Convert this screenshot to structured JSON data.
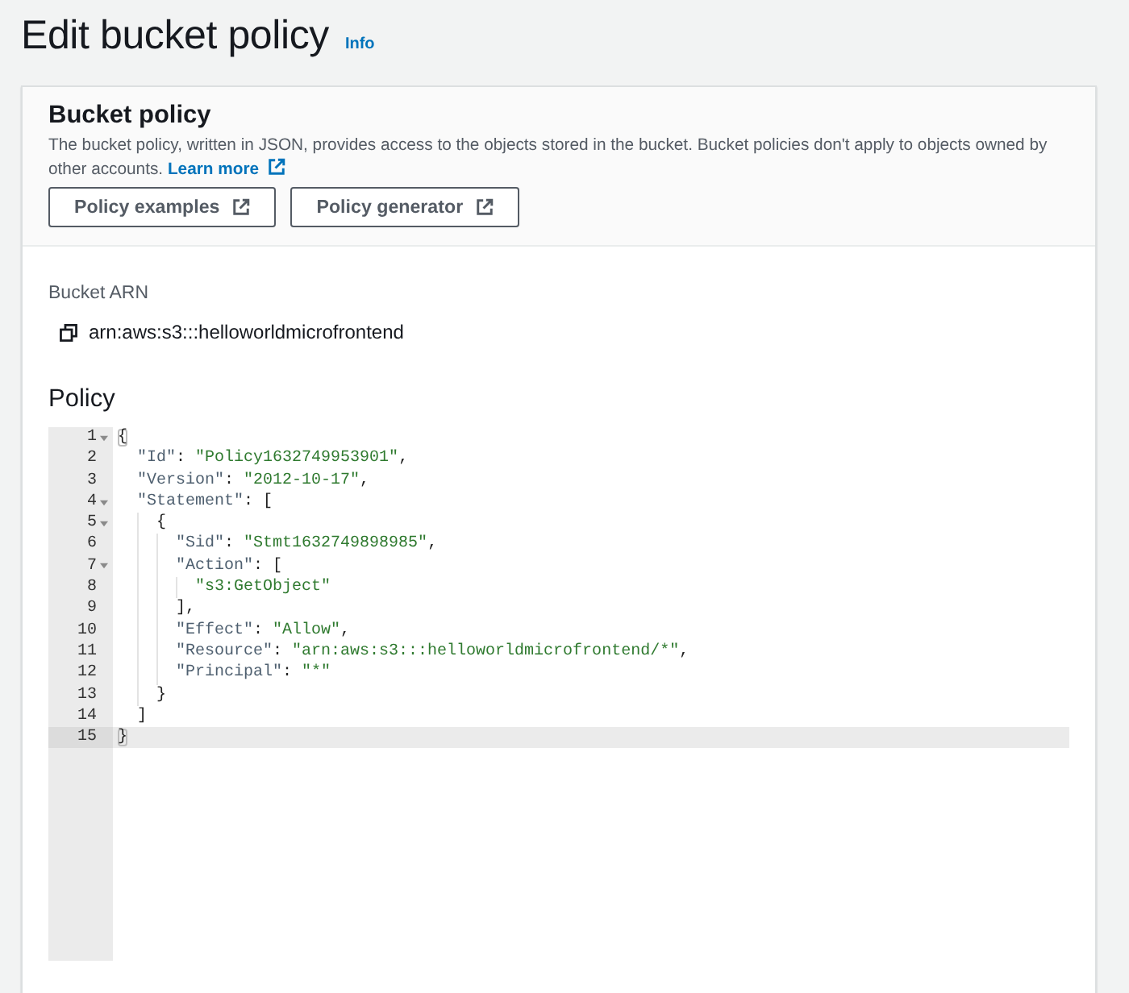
{
  "page": {
    "title": "Edit bucket policy",
    "info_link": "Info"
  },
  "bucket_policy": {
    "title": "Bucket policy",
    "description": "The bucket policy, written in JSON, provides access to the objects stored in the bucket. Bucket policies don't apply to objects owned by other accounts.",
    "learn_more": "Learn more",
    "buttons": [
      "Policy examples",
      "Policy generator"
    ]
  },
  "bucket_arn": {
    "label": "Bucket ARN",
    "value": "arn:aws:s3:::helloworldmicrofrontend"
  },
  "policy": {
    "title": "Policy",
    "editor": {
      "lines": [
        {
          "number": "1",
          "foldable": true,
          "active": false,
          "tokens": [
            {
              "kind": "match",
              "text": "{"
            }
          ]
        },
        {
          "number": "2",
          "foldable": false,
          "active": false,
          "tokens": [
            {
              "kind": "key",
              "text": "  \"Id\""
            },
            {
              "kind": "punct",
              "text": ": "
            },
            {
              "kind": "string",
              "text": "\"Policy1632749953901\""
            },
            {
              "kind": "punct",
              "text": ","
            }
          ]
        },
        {
          "number": "3",
          "foldable": false,
          "active": false,
          "tokens": [
            {
              "kind": "key",
              "text": "  \"Version\""
            },
            {
              "kind": "punct",
              "text": ": "
            },
            {
              "kind": "string",
              "text": "\"2012-10-17\""
            },
            {
              "kind": "punct",
              "text": ","
            }
          ]
        },
        {
          "number": "4",
          "foldable": true,
          "active": false,
          "tokens": [
            {
              "kind": "key",
              "text": "  \"Statement\""
            },
            {
              "kind": "punct",
              "text": ": ["
            }
          ]
        },
        {
          "number": "5",
          "foldable": true,
          "active": false,
          "tokens": [
            {
              "kind": "punct",
              "text": "    {"
            }
          ]
        },
        {
          "number": "6",
          "foldable": false,
          "active": false,
          "tokens": [
            {
              "kind": "key",
              "text": "      \"Sid\""
            },
            {
              "kind": "punct",
              "text": ": "
            },
            {
              "kind": "string",
              "text": "\"Stmt1632749898985\""
            },
            {
              "kind": "punct",
              "text": ","
            }
          ]
        },
        {
          "number": "7",
          "foldable": true,
          "active": false,
          "tokens": [
            {
              "kind": "key",
              "text": "      \"Action\""
            },
            {
              "kind": "punct",
              "text": ": ["
            }
          ]
        },
        {
          "number": "8",
          "foldable": false,
          "active": false,
          "tokens": [
            {
              "kind": "string",
              "text": "        \"s3:GetObject\""
            }
          ]
        },
        {
          "number": "9",
          "foldable": false,
          "active": false,
          "tokens": [
            {
              "kind": "punct",
              "text": "      ],"
            }
          ]
        },
        {
          "number": "10",
          "foldable": false,
          "active": false,
          "tokens": [
            {
              "kind": "key",
              "text": "      \"Effect\""
            },
            {
              "kind": "punct",
              "text": ": "
            },
            {
              "kind": "string",
              "text": "\"Allow\""
            },
            {
              "kind": "punct",
              "text": ","
            }
          ]
        },
        {
          "number": "11",
          "foldable": false,
          "active": false,
          "tokens": [
            {
              "kind": "key",
              "text": "      \"Resource\""
            },
            {
              "kind": "punct",
              "text": ": "
            },
            {
              "kind": "string",
              "text": "\"arn:aws:s3:::helloworldmicrofrontend/*\""
            },
            {
              "kind": "punct",
              "text": ","
            }
          ]
        },
        {
          "number": "12",
          "foldable": false,
          "active": false,
          "tokens": [
            {
              "kind": "key",
              "text": "      \"Principal\""
            },
            {
              "kind": "punct",
              "text": ": "
            },
            {
              "kind": "string",
              "text": "\"*\""
            }
          ]
        },
        {
          "number": "13",
          "foldable": false,
          "active": false,
          "tokens": [
            {
              "kind": "punct",
              "text": "    }"
            }
          ]
        },
        {
          "number": "14",
          "foldable": false,
          "active": false,
          "tokens": [
            {
              "kind": "punct",
              "text": "  ]"
            }
          ]
        },
        {
          "number": "15",
          "foldable": false,
          "active": true,
          "tokens": [
            {
              "kind": "match",
              "text": "}"
            }
          ]
        }
      ]
    }
  }
}
